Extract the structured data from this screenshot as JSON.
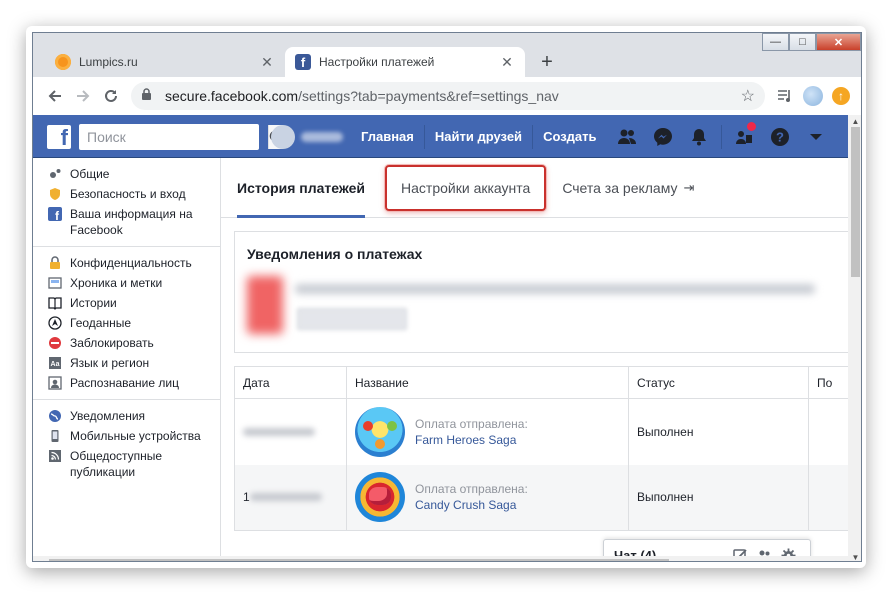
{
  "browser": {
    "tabs": [
      {
        "title": "Lumpics.ru",
        "icon": "lumpics-favicon",
        "active": false
      },
      {
        "title": "Настройки платежей",
        "icon": "facebook-favicon",
        "active": true
      }
    ],
    "new_tab": "+",
    "url_host": "secure.facebook.com",
    "url_path": "/settings?tab=payments&ref=settings_nav",
    "window_controls": {
      "minimize": "—",
      "maximize": "□",
      "close": "✕"
    }
  },
  "facebook_header": {
    "logo": "f",
    "search_placeholder": "Поиск",
    "nav": [
      "Главная",
      "Найти друзей",
      "Создать"
    ],
    "brand_color": "#4267b2"
  },
  "sidebar": {
    "groups": [
      [
        {
          "label": "Общие",
          "icon": "gears-icon"
        },
        {
          "label": "Безопасность и вход",
          "icon": "shield-icon"
        },
        {
          "label": "Ваша информация на Facebook",
          "icon": "facebook-icon"
        }
      ],
      [
        {
          "label": "Конфиденциальность",
          "icon": "lock-icon"
        },
        {
          "label": "Хроника и метки",
          "icon": "timeline-icon"
        },
        {
          "label": "Истории",
          "icon": "book-icon"
        },
        {
          "label": "Геоданные",
          "icon": "location-icon"
        },
        {
          "label": "Заблокировать",
          "icon": "block-icon"
        },
        {
          "label": "Язык и регион",
          "icon": "language-icon"
        },
        {
          "label": "Распознавание лиц",
          "icon": "face-icon"
        }
      ],
      [
        {
          "label": "Уведомления",
          "icon": "globe-icon"
        },
        {
          "label": "Мобильные устройства",
          "icon": "phone-icon"
        },
        {
          "label": "Общедоступные публикации",
          "icon": "rss-icon"
        }
      ]
    ]
  },
  "settings_tabs": {
    "history": "История платежей",
    "account": "Настройки аккаунта",
    "ads": "Счета за рекламу",
    "ads_icon": "⇥"
  },
  "notifications": {
    "title": "Уведомления о платежах"
  },
  "payments_table": {
    "columns": [
      "Дата",
      "Название",
      "Статус",
      "По"
    ],
    "rows": [
      {
        "date_prefix": "",
        "sub": "Оплата отправлена:",
        "app": "Farm Heroes Saga",
        "status": "Выполнен",
        "icon": "farm-heroes-saga-icon"
      },
      {
        "date_prefix": "1",
        "sub": "Оплата отправлена:",
        "app": "Candy Crush Saga",
        "status": "Выполнен",
        "icon": "candy-crush-saga-icon"
      }
    ]
  },
  "chat": {
    "title": "Чат (4)"
  }
}
